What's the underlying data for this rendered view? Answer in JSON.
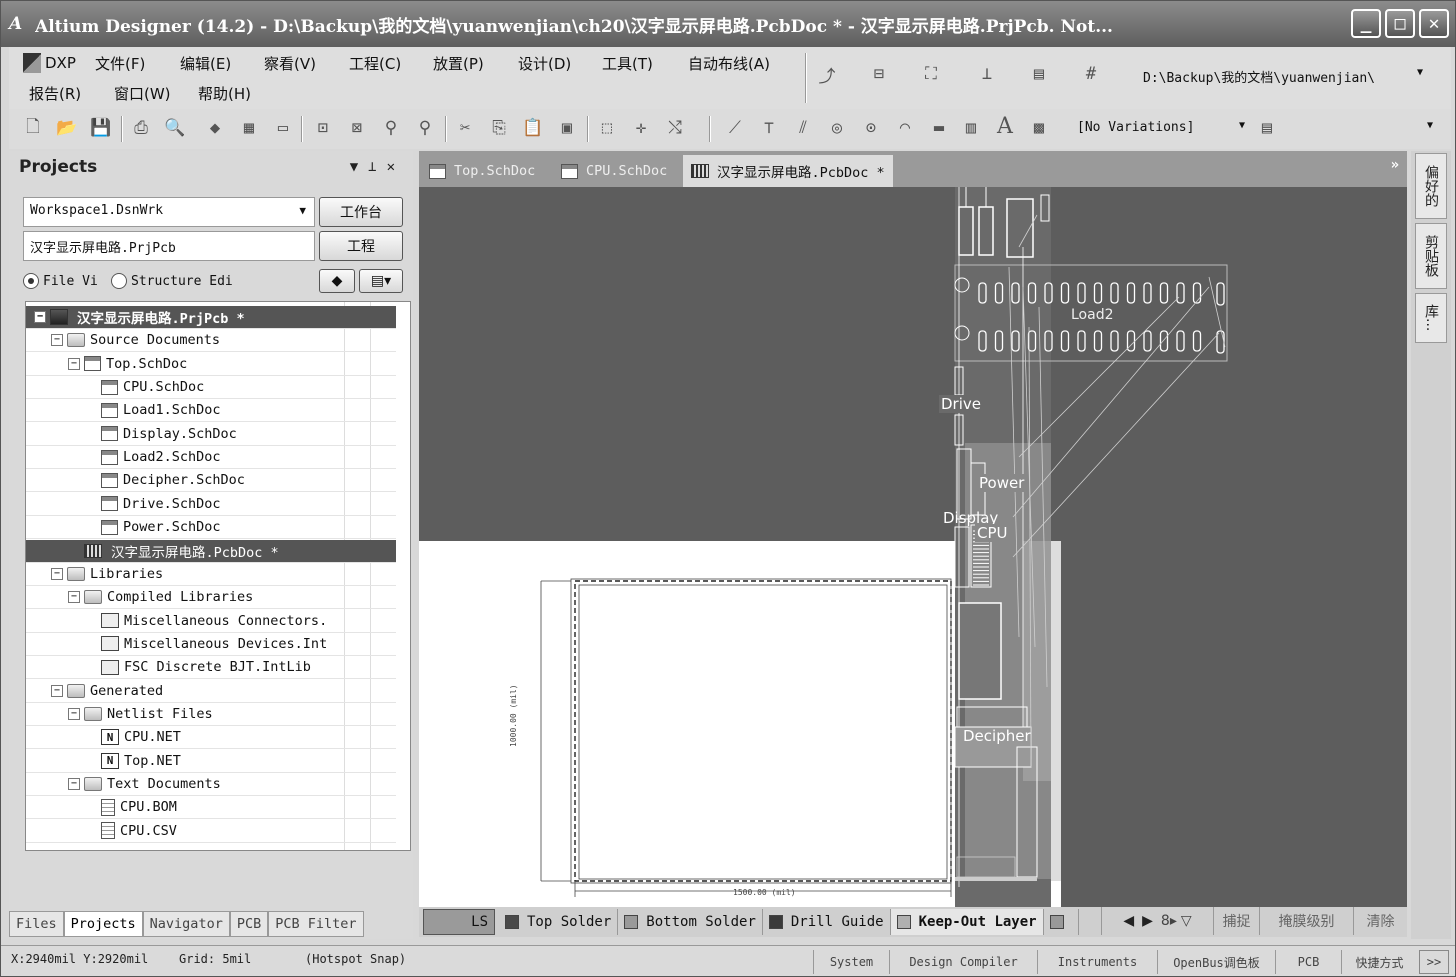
{
  "title_bar": {
    "logo": "A",
    "title": "Altium Designer (14.2) - D:\\Backup\\我的文档\\yuanwenjian\\ch20\\汉字显示屏电路.PcbDoc * - 汉字显示屏电路.PrjPcb. Not...",
    "minimize": "_",
    "maximize": "□",
    "close": "✕"
  },
  "menu": {
    "dxp": "DXP",
    "items": [
      "文件(F)",
      "编辑(E)",
      "察看(V)",
      "工程(C)",
      "放置(P)",
      "设计(D)",
      "工具(T)",
      "自动布线(A)"
    ],
    "items_row2": [
      "报告(R)",
      "窗口(W)",
      "帮助(H)"
    ],
    "path_combo": "D:\\Backup\\我的文档\\yuanwenjian\\",
    "variations_combo": "[No Variations]",
    "empty_combo": ""
  },
  "projects_panel": {
    "title": "Projects",
    "workspace": "Workspace1.DsnWrk",
    "workspace_button": "工作台",
    "project": "汉字显示屏电路.PrjPcb",
    "project_button": "工程",
    "radio_file_view": "File Vi",
    "radio_structure": "Structure Edi",
    "tree": [
      {
        "label": "汉字显示屏电路.PrjPcb *",
        "level": 0,
        "icon": "project-icon",
        "exp": "−",
        "state": "selected"
      },
      {
        "label": "Source Documents",
        "level": 1,
        "icon": "folder-icon",
        "exp": "−"
      },
      {
        "label": "Top.SchDoc",
        "level": 2,
        "icon": "schematic-icon",
        "exp": "−"
      },
      {
        "label": "CPU.SchDoc",
        "level": 3,
        "icon": "schematic-icon"
      },
      {
        "label": "Load1.SchDoc",
        "level": 3,
        "icon": "schematic-icon"
      },
      {
        "label": "Display.SchDoc",
        "level": 3,
        "icon": "schematic-icon"
      },
      {
        "label": "Load2.SchDoc",
        "level": 3,
        "icon": "schematic-icon"
      },
      {
        "label": "Decipher.SchDoc",
        "level": 3,
        "icon": "schematic-icon"
      },
      {
        "label": "Drive.SchDoc",
        "level": 3,
        "icon": "schematic-icon"
      },
      {
        "label": "Power.SchDoc",
        "level": 3,
        "icon": "schematic-icon"
      },
      {
        "label": "汉字显示屏电路.PcbDoc *",
        "level": 2,
        "icon": "pcb-icon",
        "state": "highlight"
      },
      {
        "label": "Libraries",
        "level": 1,
        "icon": "folder-icon",
        "exp": "−"
      },
      {
        "label": "Compiled Libraries",
        "level": 2,
        "icon": "folder-icon",
        "exp": "−"
      },
      {
        "label": "Miscellaneous Connectors.",
        "level": 3,
        "icon": "library-icon"
      },
      {
        "label": "Miscellaneous Devices.Int",
        "level": 3,
        "icon": "library-icon"
      },
      {
        "label": "FSC Discrete BJT.IntLib",
        "level": 3,
        "icon": "library-icon"
      },
      {
        "label": "Generated",
        "level": 1,
        "icon": "folder-icon",
        "exp": "−"
      },
      {
        "label": "Netlist Files",
        "level": 2,
        "icon": "folder-icon",
        "exp": "−"
      },
      {
        "label": "CPU.NET",
        "level": 3,
        "icon": "netlist-icon"
      },
      {
        "label": "Top.NET",
        "level": 3,
        "icon": "netlist-icon"
      },
      {
        "label": "Text Documents",
        "level": 2,
        "icon": "folder-icon",
        "exp": "−"
      },
      {
        "label": "CPU.BOM",
        "level": 3,
        "icon": "text-file-icon"
      },
      {
        "label": "CPU.CSV",
        "level": 3,
        "icon": "text-file-icon"
      }
    ],
    "bottom_tabs": [
      "Files",
      "Projects",
      "Navigator",
      "PCB",
      "PCB Filter"
    ],
    "active_bottom_tab": "Projects"
  },
  "document_tabs": [
    {
      "label": "Top.SchDoc",
      "active": false
    },
    {
      "label": "CPU.SchDoc",
      "active": false
    },
    {
      "label": "汉字显示屏电路.PcbDoc *",
      "active": true
    }
  ],
  "right_panels": [
    "偏好的",
    "剪贴板",
    "库..."
  ],
  "pcb": {
    "component_labels": [
      "Load2",
      "Drive",
      "Power",
      "Display",
      "CPU",
      "Decipher"
    ],
    "dimension_bottom": "1500.00 (mil)",
    "dimension_left": "1000.00 (mil)"
  },
  "layer_tabs": [
    {
      "label": "LS",
      "color": "#8a8a8a"
    },
    {
      "label": "Top Solder",
      "color": "#4a4a4a"
    },
    {
      "label": "Bottom Solder",
      "color": "#9a9a9a"
    },
    {
      "label": "Drill Guide",
      "color": "#3a3a3a"
    },
    {
      "label": "Keep-Out Layer",
      "color": "#b0b0b0"
    }
  ],
  "layer_right_buttons": [
    "捕捉",
    "掩膜级别",
    "清除"
  ],
  "status": {
    "coords": "X:2940mil Y:2920mil",
    "grid": "Grid: 5mil",
    "snap": "(Hotspot Snap)",
    "buttons": [
      "System",
      "Design Compiler",
      "Instruments",
      "OpenBus调色板",
      "PCB",
      "快捷方式"
    ],
    "more": ">>"
  }
}
